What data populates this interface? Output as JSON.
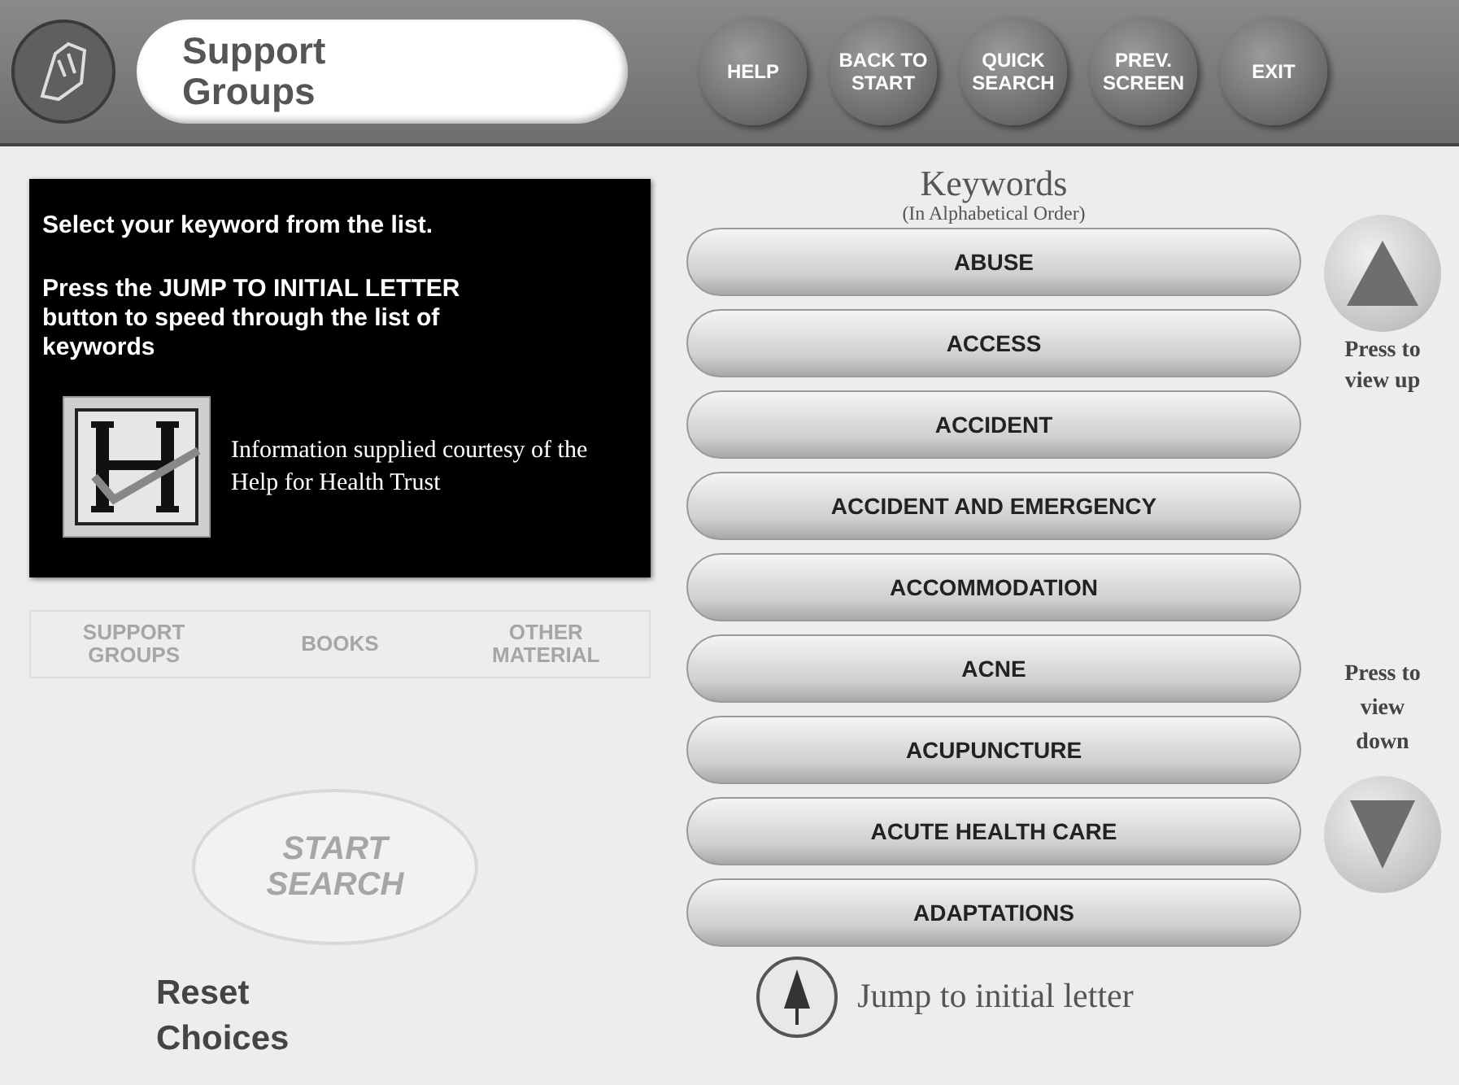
{
  "header": {
    "title": "Support Groups",
    "buttons": [
      {
        "label": "HELP"
      },
      {
        "label": "BACK TO START"
      },
      {
        "label": "QUICK SEARCH"
      },
      {
        "label": "PREV. SCREEN"
      },
      {
        "label": "EXIT"
      }
    ]
  },
  "info_panel": {
    "instruction": "Select your keyword from the list.",
    "jump_hint": "Press the JUMP TO INITIAL LETTER button to speed through the list of keywords",
    "credit": "Information supplied courtesy of the Help for Health Trust"
  },
  "category_tabs": [
    {
      "label": "SUPPORT GROUPS",
      "disabled": true
    },
    {
      "label": "BOOKS",
      "disabled": true
    },
    {
      "label": "OTHER MATERIAL",
      "disabled": true
    }
  ],
  "start_search": {
    "label": "START SEARCH",
    "disabled": true
  },
  "reset_choices": "Reset Choices",
  "keywords": {
    "title": "Keywords",
    "subtitle": "(In Alphabetical Order)",
    "items": [
      "ABUSE",
      "ACCESS",
      "ACCIDENT",
      "ACCIDENT AND EMERGENCY",
      "ACCOMMODATION",
      "ACNE",
      "ACUPUNCTURE",
      "ACUTE HEALTH CARE",
      "ADAPTATIONS"
    ]
  },
  "scroll_up_label": "Press to view up",
  "scroll_down_label": "Press to view down",
  "jump_label": "Jump to initial letter"
}
